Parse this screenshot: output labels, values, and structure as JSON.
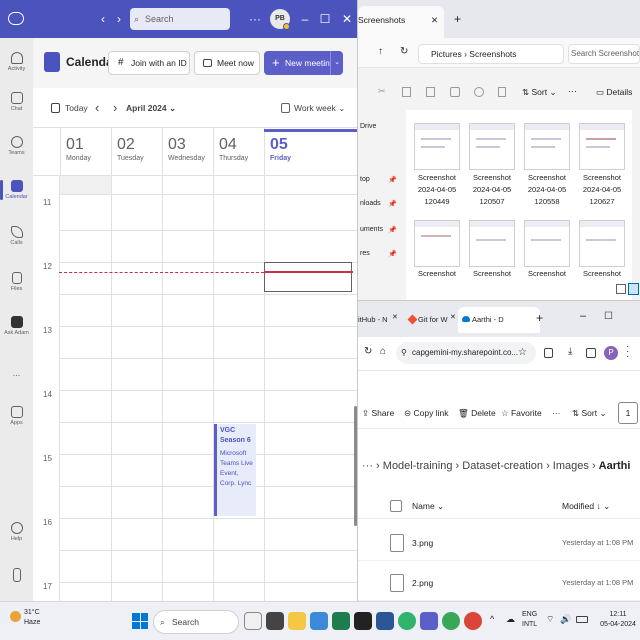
{
  "teams": {
    "search_placeholder": "Search",
    "avatar_initials": "PB",
    "rail": [
      "Activity",
      "Chat",
      "Teams",
      "Calendar",
      "Calls",
      "Files",
      "Ask Adam",
      "...",
      "Apps",
      "Help"
    ],
    "header": {
      "title": "Calendar",
      "join_label": "Join with an ID",
      "meet_label": "Meet now",
      "new_label": "New meeting"
    },
    "nav": {
      "today": "Today",
      "month": "April 2024",
      "view": "Work week"
    },
    "days": [
      {
        "num": "01",
        "name": "Monday"
      },
      {
        "num": "02",
        "name": "Tuesday"
      },
      {
        "num": "03",
        "name": "Wednesday"
      },
      {
        "num": "04",
        "name": "Thursday"
      },
      {
        "num": "05",
        "name": "Friday"
      }
    ],
    "hours": [
      "11",
      "12",
      "13",
      "14",
      "15",
      "16",
      "17"
    ],
    "event": {
      "title": "VGC Season 6",
      "subtitle": "Microsoft Teams Live Event, Corp. Lync"
    }
  },
  "explorer": {
    "tab_title": "Screenshots",
    "path": [
      "Pictures",
      "Screenshots"
    ],
    "search_placeholder": "Search Screenshots",
    "sort_label": "Sort",
    "details_label": "Details",
    "sidebar": [
      "Drive",
      "top",
      "nloads",
      "uments",
      "res"
    ],
    "thumbnails": [
      {
        "caption": "Screenshot 2024-04-05 120449"
      },
      {
        "caption": "Screenshot 2024-04-05 120507"
      },
      {
        "caption": "Screenshot 2024-04-05 120558"
      },
      {
        "caption": "Screenshot 2024-04-05 120627"
      },
      {
        "caption": "Screenshot"
      },
      {
        "caption": "Screenshot"
      },
      {
        "caption": "Screenshot"
      },
      {
        "caption": "Screenshot"
      }
    ]
  },
  "edge": {
    "tabs": [
      "itHub - N",
      "Git for W",
      "Aarthi - D"
    ],
    "url": "capgemini-my.sharepoint.co...",
    "profile_initial": "P",
    "commands": {
      "share": "Share",
      "copy_link": "Copy link",
      "delete": "Delete",
      "favorite": "Favorite",
      "sort": "Sort"
    },
    "breadcrumb": [
      "Model-training",
      "Dataset-creation",
      "Images",
      "Aarthi"
    ],
    "columns": {
      "name": "Name",
      "modified": "Modified"
    },
    "files": [
      {
        "name": "3.png",
        "modified": "Yesterday at 1:08 PM"
      },
      {
        "name": "2.png",
        "modified": "Yesterday at 1:08 PM"
      }
    ]
  },
  "taskbar": {
    "weather_temp": "31°C",
    "weather_desc": "Haze",
    "search_label": "Search",
    "lang": "ENG",
    "lang_sub": "INTL",
    "time": "12:11",
    "date": "05-04-2024"
  },
  "colors": {
    "teams_brand": "#4b53bc",
    "teams_button": "#5b5fc7",
    "now_line": "#c4314b"
  }
}
